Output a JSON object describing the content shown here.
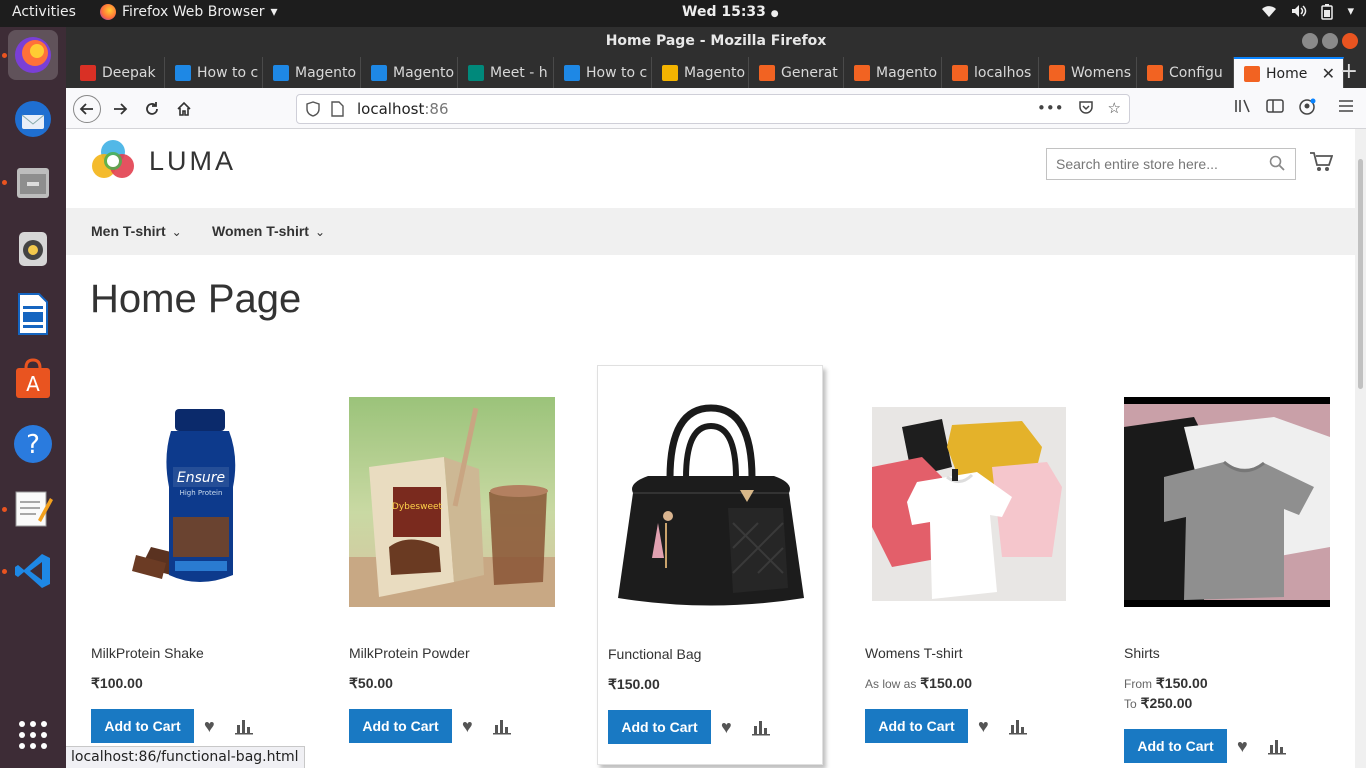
{
  "topbar": {
    "activities": "Activities",
    "app_name": "Firefox Web Browser",
    "clock": "Wed 15:33"
  },
  "dock": {
    "items": [
      "firefox-icon",
      "thunderbird-icon",
      "files-icon",
      "rhythmbox-icon",
      "writer-icon",
      "software-icon",
      "help-icon",
      "text-editor-icon",
      "vscode-icon",
      "show-apps-icon"
    ]
  },
  "window": {
    "title": "Home Page - Mozilla Firefox"
  },
  "tabs": [
    {
      "label": "Deepak",
      "icon": "gmail-icon",
      "color": "#d93025"
    },
    {
      "label": "How to c",
      "icon": "stack-icon",
      "color": "#1e88e5"
    },
    {
      "label": "Magento",
      "icon": "stack-icon",
      "color": "#1e88e5"
    },
    {
      "label": "Magento",
      "icon": "stack-icon",
      "color": "#1e88e5"
    },
    {
      "label": "Meet - h",
      "icon": "meet-icon",
      "color": "#00897b"
    },
    {
      "label": "How to c",
      "icon": "stack-icon",
      "color": "#1e88e5"
    },
    {
      "label": "Magento",
      "icon": "slides-icon",
      "color": "#f4b400"
    },
    {
      "label": "Generat",
      "icon": "magento-icon",
      "color": "#f26322"
    },
    {
      "label": "Magento",
      "icon": "magento-icon",
      "color": "#f26322"
    },
    {
      "label": "localhos",
      "icon": "magento-icon",
      "color": "#f26322"
    },
    {
      "label": "Womens",
      "icon": "magento-icon",
      "color": "#f26322"
    },
    {
      "label": "Configu",
      "icon": "magento-icon",
      "color": "#f26322"
    },
    {
      "label": "Home",
      "icon": "magento-icon",
      "color": "#f26322",
      "active": true
    }
  ],
  "urlbar": {
    "host": "localhost",
    "port": ":86"
  },
  "store": {
    "logo_text": "LUMA",
    "search_placeholder": "Search entire store here...",
    "menu": [
      "Men T-shirt",
      "Women T-shirt"
    ],
    "page_title": "Home Page"
  },
  "products": [
    {
      "name": "MilkProtein Shake",
      "price_label": "",
      "price": "₹100.00",
      "price2_label": "",
      "price2": "",
      "image": "protein-shake-bottle"
    },
    {
      "name": "MilkProtein Powder",
      "price_label": "",
      "price": "₹50.00",
      "price2_label": "",
      "price2": "",
      "image": "protein-powder-box"
    },
    {
      "name": "Functional Bag",
      "price_label": "",
      "price": "₹150.00",
      "price2_label": "",
      "price2": "",
      "image": "black-handbag"
    },
    {
      "name": "Womens T-shirt",
      "price_label": "As low as",
      "price": "₹150.00",
      "price2_label": "",
      "price2": "",
      "image": "colorful-tshirts"
    },
    {
      "name": "Shirts",
      "price_label": "From",
      "price": "₹150.00",
      "price2_label": "To",
      "price2": "₹250.00",
      "image": "grey-tshirts"
    }
  ],
  "add_to_cart": "Add to Cart",
  "status_url": "localhost:86/functional-bag.html",
  "colors": {
    "button_blue": "#1979c3",
    "menu_bg": "#f0f0f0",
    "dock_bg": "#3d2c36",
    "topbar_bg": "#1d1d1d"
  }
}
